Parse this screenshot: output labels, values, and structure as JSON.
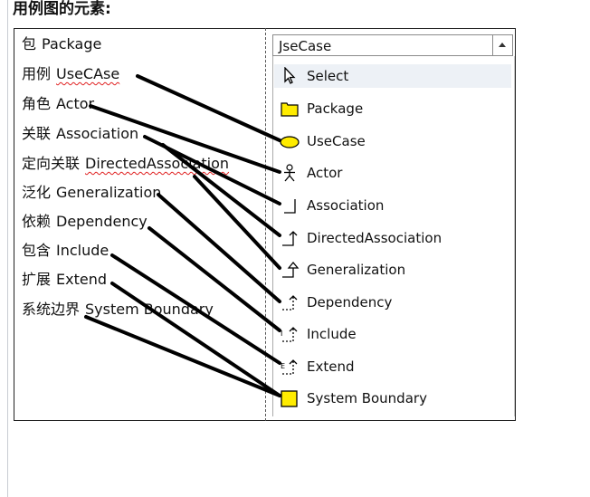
{
  "heading": "用例图的元素:",
  "left_list": [
    {
      "zh": "包",
      "en": "Package"
    },
    {
      "zh": "用例",
      "en": "UseCAse"
    },
    {
      "zh": "角色",
      "en": "Actor"
    },
    {
      "zh": "关联",
      "en": "Association"
    },
    {
      "zh": "定向关联",
      "en": "DirectedAssociation"
    },
    {
      "zh": "泛化",
      "en": "Generalization"
    },
    {
      "zh": "依赖",
      "en": "Dependency"
    },
    {
      "zh": "包含",
      "en": "Include"
    },
    {
      "zh": "扩展",
      "en": "Extend"
    },
    {
      "zh": "系统边界",
      "en": "System Boundary"
    }
  ],
  "palette": {
    "dropdown_value": "JseCase",
    "items": [
      {
        "label": "Select",
        "icon": "cursor-icon"
      },
      {
        "label": "Package",
        "icon": "package-icon"
      },
      {
        "label": "UseCase",
        "icon": "usecase-ellipse-icon"
      },
      {
        "label": "Actor",
        "icon": "actor-stick-figure-icon"
      },
      {
        "label": "Association",
        "icon": "association-line-icon"
      },
      {
        "label": "DirectedAssociation",
        "icon": "directed-association-arrow-icon"
      },
      {
        "label": "Generalization",
        "icon": "generalization-arrow-icon"
      },
      {
        "label": "Dependency",
        "icon": "dependency-dashed-arrow-icon"
      },
      {
        "label": "Include",
        "icon": "include-arrow-icon"
      },
      {
        "label": "Extend",
        "icon": "extend-arrow-icon"
      },
      {
        "label": "System Boundary",
        "icon": "system-boundary-box-icon"
      }
    ]
  },
  "colors": {
    "usecase_fill": "#ffec00",
    "package_fill": "#ffec00",
    "boundary_fill": "#ffec00",
    "selected_row": "#edf1f6",
    "squiggle": "#e02020"
  }
}
